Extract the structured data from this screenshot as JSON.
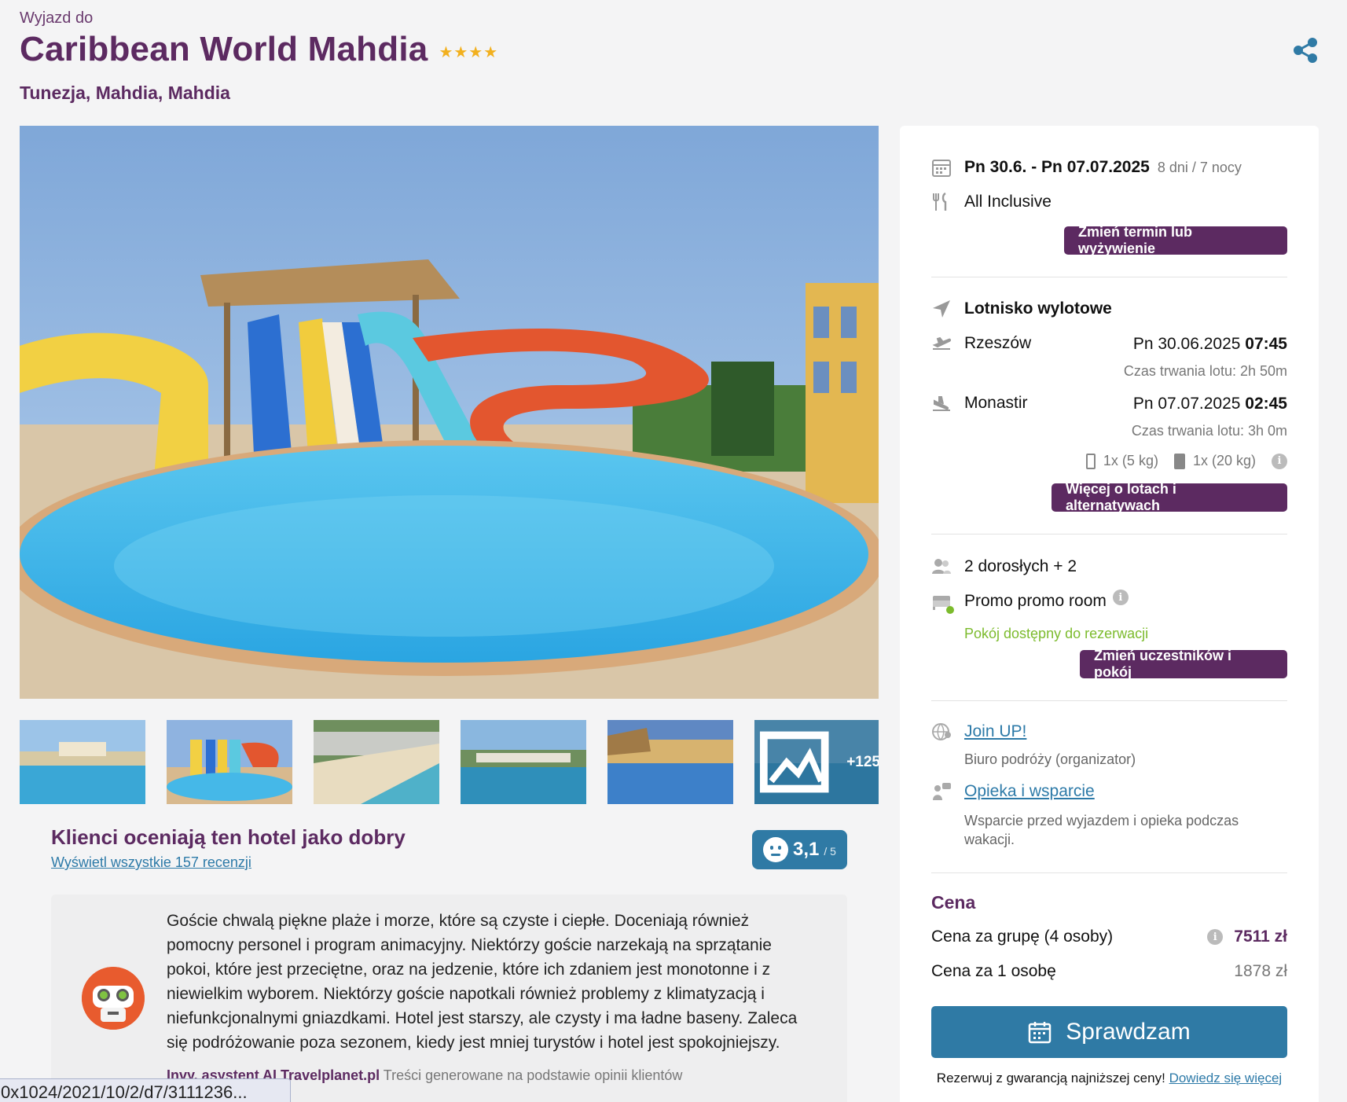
{
  "header": {
    "pretitle": "Wyjazd do",
    "hotel_name": "Caribbean World Mahdia",
    "stars": "★★★★",
    "location": "Tunezja, Mahdia, Mahdia"
  },
  "gallery": {
    "more_label": "+125"
  },
  "rating": {
    "title": "Klienci oceniają ten hotel jako dobry",
    "reviews_link": "Wyświetl wszystkie 157 recenzji",
    "score": "3,1",
    "max": "/ 5"
  },
  "review": {
    "text": "Goście chwalą piękne plaże i morze, które są czyste i ciepłe. Doceniają również pomocny personel i program animacyjny. Niektórzy goście narzekają na sprzątanie pokoi, które jest przeciętne, oraz na jedzenie, które ich zdaniem jest monotonne i z niewielkim wyborem. Niektórzy goście napotkali również problemy z klimatyzacją i niefunkcjonalnymi gniazdkami. Hotel jest starszy, ale czysty i ma ładne baseny. Zaleca się podróżowanie poza sezonem, kiedy jest mniej turystów i hotel jest spokojniejszy.",
    "source_name": "Invy, asystent AI Travelplanet.pl",
    "source_note": "Treści generowane na podstawie opinii klientów"
  },
  "url_tooltip": "0x1024/2021/10/2/d7/3111236...",
  "sidebar": {
    "dates": "Pn 30.6. - Pn 07.07.2025",
    "duration": "8 dni / 7 nocy",
    "board": "All Inclusive",
    "change_term_btn": "Zmień termin lub wyżywienie",
    "airport_label": "Lotnisko wylotowe",
    "outbound_city": "Rzeszów",
    "outbound_date": "Pn 30.06.2025",
    "outbound_time": "07:45",
    "outbound_duration": "Czas trwania lotu: 2h 50m",
    "return_city": "Monastir",
    "return_date": "Pn 07.07.2025",
    "return_time": "02:45",
    "return_duration": "Czas trwania lotu: 3h 0m",
    "hand_luggage": "1x (5 kg)",
    "checked_luggage": "1x (20 kg)",
    "more_flights_btn": "Więcej o lotach i alternatywach",
    "participants": "2 dorosłych + 2",
    "room": "Promo promo room",
    "room_status": "Pokój dostępny do rezerwacji",
    "change_room_btn": "Zmień uczestników i pokój",
    "organizer_link": "Join UP!",
    "organizer_sub": "Biuro podróży (organizator)",
    "support_link": "Opieka i wsparcie",
    "support_sub": "Wsparcie przed wyjazdem i opieka podczas wakacji.",
    "price_title": "Cena",
    "group_price_label": "Cena za grupę (4 osoby)",
    "group_price": "7511 zł",
    "person_price_label": "Cena za 1 osobę",
    "person_price": "1878 zł",
    "check_btn": "Sprawdzam",
    "guarantee_text": "Rezerwuj z gwarancją najniższej ceny!",
    "guarantee_link": "Dowiedz się więcej"
  },
  "colors": {
    "brand_purple": "#5c2a61",
    "accent_blue": "#2f7aa5",
    "available_green": "#7cbb2d",
    "star_gold": "#f2b01e"
  }
}
